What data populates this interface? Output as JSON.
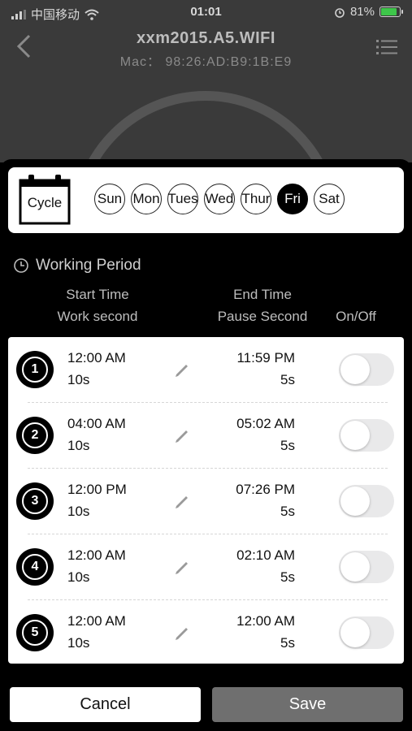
{
  "status_bar": {
    "carrier": "中国移动",
    "time": "01:01",
    "battery": "81%"
  },
  "header": {
    "title": "xxm2015.A5.WIFI",
    "mac": "Mac：  98:26:AD:B9:1B:E9"
  },
  "cycle": {
    "label": "Cycle",
    "days": [
      {
        "label": "Sun",
        "active": false
      },
      {
        "label": "Mon",
        "active": false
      },
      {
        "label": "Tues",
        "active": false
      },
      {
        "label": "Wed",
        "active": false
      },
      {
        "label": "Thur",
        "active": false
      },
      {
        "label": "Fri",
        "active": true
      },
      {
        "label": "Sat",
        "active": false
      }
    ]
  },
  "working_period": {
    "title": "Working Period",
    "headers": {
      "start_time": "Start Time",
      "work_second": "Work second",
      "end_time": "End Time",
      "pause_second": "Pause Second",
      "on_off": "On/Off"
    },
    "rows": [
      {
        "num": "1",
        "start": "12:00 AM",
        "work": "10s",
        "end": "11:59 PM",
        "pause": "5s",
        "on": false
      },
      {
        "num": "2",
        "start": "04:00 AM",
        "work": "10s",
        "end": "05:02 AM",
        "pause": "5s",
        "on": false
      },
      {
        "num": "3",
        "start": "12:00 PM",
        "work": "10s",
        "end": "07:26 PM",
        "pause": "5s",
        "on": false
      },
      {
        "num": "4",
        "start": "12:00 AM",
        "work": "10s",
        "end": "02:10 AM",
        "pause": "5s",
        "on": false
      },
      {
        "num": "5",
        "start": "12:00 AM",
        "work": "10s",
        "end": "12:00 AM",
        "pause": "5s",
        "on": false
      }
    ]
  },
  "buttons": {
    "cancel": "Cancel",
    "save": "Save"
  },
  "colors": {
    "active_day": "#000000",
    "save_button": "#6f6f6f",
    "toggle_off": "#e9e9ea",
    "battery": "#3ec64a"
  }
}
